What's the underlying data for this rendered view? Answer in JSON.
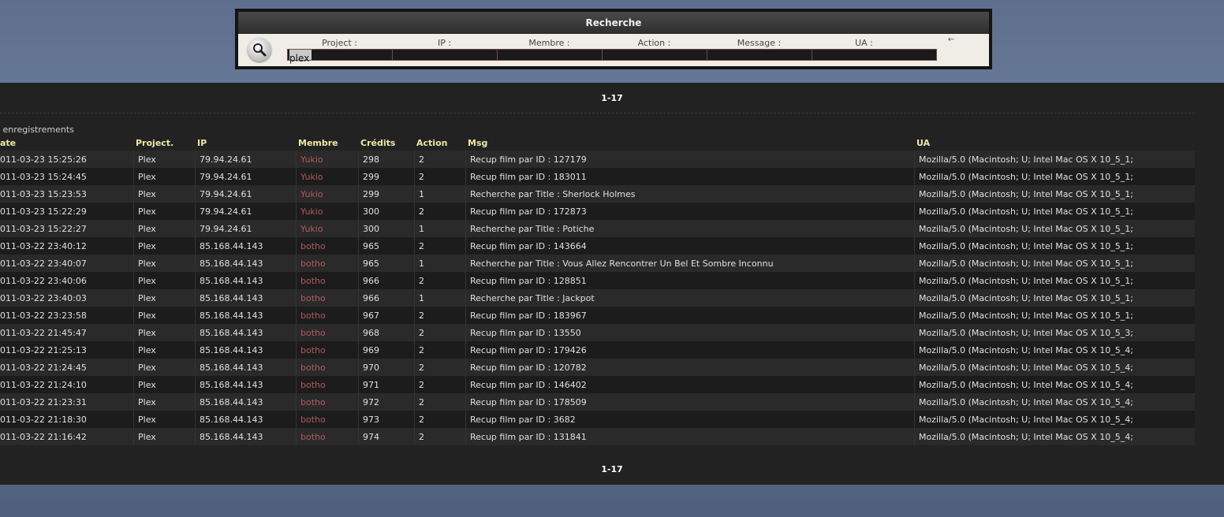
{
  "search": {
    "title": "Recherche",
    "labels": [
      "Project :",
      "IP :",
      "Membre :",
      "Action :",
      "Message :",
      "UA :"
    ],
    "project_value": "plex",
    "arrow": "←"
  },
  "pager": {
    "top": "1-17",
    "bottom": "1-17"
  },
  "record_count_label": "enregistrements",
  "table": {
    "headers": {
      "date": "ate",
      "project": "Project.",
      "ip": "IP",
      "member": "Membre",
      "credits": "Crédits",
      "action": "Action",
      "msg": "Msg",
      "ua": "UA"
    },
    "rows": [
      {
        "date": "011-03-23 15:25:26",
        "project": "Plex",
        "ip": "79.94.24.61",
        "member": "Yukio",
        "credits": "298",
        "action": "2",
        "msg": "Recup film par ID : 127179",
        "ua": "Mozilla/5.0 (Macintosh; U; Intel Mac OS X 10_5_1;"
      },
      {
        "date": "011-03-23 15:24:45",
        "project": "Plex",
        "ip": "79.94.24.61",
        "member": "Yukio",
        "credits": "299",
        "action": "2",
        "msg": "Recup film par ID : 183011",
        "ua": "Mozilla/5.0 (Macintosh; U; Intel Mac OS X 10_5_1;"
      },
      {
        "date": "011-03-23 15:23:53",
        "project": "Plex",
        "ip": "79.94.24.61",
        "member": "Yukio",
        "credits": "299",
        "action": "1",
        "msg": "Recherche par Title : Sherlock Holmes",
        "ua": "Mozilla/5.0 (Macintosh; U; Intel Mac OS X 10_5_1;"
      },
      {
        "date": "011-03-23 15:22:29",
        "project": "Plex",
        "ip": "79.94.24.61",
        "member": "Yukio",
        "credits": "300",
        "action": "2",
        "msg": "Recup film par ID : 172873",
        "ua": "Mozilla/5.0 (Macintosh; U; Intel Mac OS X 10_5_1;"
      },
      {
        "date": "011-03-23 15:22:27",
        "project": "Plex",
        "ip": "79.94.24.61",
        "member": "Yukio",
        "credits": "300",
        "action": "1",
        "msg": "Recherche par Title : Potiche",
        "ua": "Mozilla/5.0 (Macintosh; U; Intel Mac OS X 10_5_1;"
      },
      {
        "date": "011-03-22 23:40:12",
        "project": "Plex",
        "ip": "85.168.44.143",
        "member": "botho",
        "credits": "965",
        "action": "2",
        "msg": "Recup film par ID : 143664",
        "ua": "Mozilla/5.0 (Macintosh; U; Intel Mac OS X 10_5_1;"
      },
      {
        "date": "011-03-22 23:40:07",
        "project": "Plex",
        "ip": "85.168.44.143",
        "member": "botho",
        "credits": "965",
        "action": "1",
        "msg": "Recherche par Title : Vous Allez Rencontrer Un Bel Et Sombre Inconnu",
        "ua": "Mozilla/5.0 (Macintosh; U; Intel Mac OS X 10_5_1;"
      },
      {
        "date": "011-03-22 23:40:06",
        "project": "Plex",
        "ip": "85.168.44.143",
        "member": "botho",
        "credits": "966",
        "action": "2",
        "msg": "Recup film par ID : 128851",
        "ua": "Mozilla/5.0 (Macintosh; U; Intel Mac OS X 10_5_1;"
      },
      {
        "date": "011-03-22 23:40:03",
        "project": "Plex",
        "ip": "85.168.44.143",
        "member": "botho",
        "credits": "966",
        "action": "1",
        "msg": "Recherche par Title : Jackpot",
        "ua": "Mozilla/5.0 (Macintosh; U; Intel Mac OS X 10_5_1;"
      },
      {
        "date": "011-03-22 23:23:58",
        "project": "Plex",
        "ip": "85.168.44.143",
        "member": "botho",
        "credits": "967",
        "action": "2",
        "msg": "Recup film par ID : 183967",
        "ua": "Mozilla/5.0 (Macintosh; U; Intel Mac OS X 10_5_1;"
      },
      {
        "date": "011-03-22 21:45:47",
        "project": "Plex",
        "ip": "85.168.44.143",
        "member": "botho",
        "credits": "968",
        "action": "2",
        "msg": "Recup film par ID : 13550",
        "ua": "Mozilla/5.0 (Macintosh; U; Intel Mac OS X 10_5_3;"
      },
      {
        "date": "011-03-22 21:25:13",
        "project": "Plex",
        "ip": "85.168.44.143",
        "member": "botho",
        "credits": "969",
        "action": "2",
        "msg": "Recup film par ID : 179426",
        "ua": "Mozilla/5.0 (Macintosh; U; Intel Mac OS X 10_5_4;"
      },
      {
        "date": "011-03-22 21:24:45",
        "project": "Plex",
        "ip": "85.168.44.143",
        "member": "botho",
        "credits": "970",
        "action": "2",
        "msg": "Recup film par ID : 120782",
        "ua": "Mozilla/5.0 (Macintosh; U; Intel Mac OS X 10_5_4;"
      },
      {
        "date": "011-03-22 21:24:10",
        "project": "Plex",
        "ip": "85.168.44.143",
        "member": "botho",
        "credits": "971",
        "action": "2",
        "msg": "Recup film par ID : 146402",
        "ua": "Mozilla/5.0 (Macintosh; U; Intel Mac OS X 10_5_4;"
      },
      {
        "date": "011-03-22 21:23:31",
        "project": "Plex",
        "ip": "85.168.44.143",
        "member": "botho",
        "credits": "972",
        "action": "2",
        "msg": "Recup film par ID : 178509",
        "ua": "Mozilla/5.0 (Macintosh; U; Intel Mac OS X 10_5_4;"
      },
      {
        "date": "011-03-22 21:18:30",
        "project": "Plex",
        "ip": "85.168.44.143",
        "member": "botho",
        "credits": "973",
        "action": "2",
        "msg": "Recup film par ID : 3682",
        "ua": "Mozilla/5.0 (Macintosh; U; Intel Mac OS X 10_5_4;"
      },
      {
        "date": "011-03-22 21:16:42",
        "project": "Plex",
        "ip": "85.168.44.143",
        "member": "botho",
        "credits": "974",
        "action": "2",
        "msg": "Recup film par ID : 131841",
        "ua": "Mozilla/5.0 (Macintosh; U; Intel Mac OS X 10_5_4;"
      }
    ]
  },
  "colors": {
    "member_link": "#b35a5a",
    "header_text": "#efe7a8",
    "panel_bg": "#222222"
  },
  "icons": {
    "search": "magnifier-icon"
  }
}
